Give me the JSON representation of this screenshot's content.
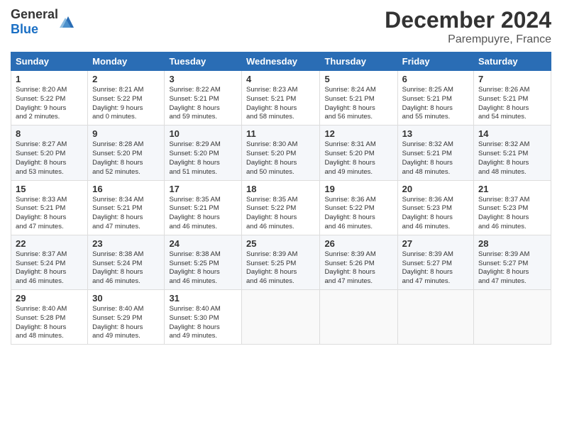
{
  "header": {
    "logo_general": "General",
    "logo_blue": "Blue",
    "title": "December 2024",
    "subtitle": "Parempuyre, France"
  },
  "calendar": {
    "columns": [
      "Sunday",
      "Monday",
      "Tuesday",
      "Wednesday",
      "Thursday",
      "Friday",
      "Saturday"
    ],
    "weeks": [
      [
        {
          "day": "1",
          "info": "Sunrise: 8:20 AM\nSunset: 5:22 PM\nDaylight: 9 hours\nand 2 minutes."
        },
        {
          "day": "2",
          "info": "Sunrise: 8:21 AM\nSunset: 5:22 PM\nDaylight: 9 hours\nand 0 minutes."
        },
        {
          "day": "3",
          "info": "Sunrise: 8:22 AM\nSunset: 5:21 PM\nDaylight: 8 hours\nand 59 minutes."
        },
        {
          "day": "4",
          "info": "Sunrise: 8:23 AM\nSunset: 5:21 PM\nDaylight: 8 hours\nand 58 minutes."
        },
        {
          "day": "5",
          "info": "Sunrise: 8:24 AM\nSunset: 5:21 PM\nDaylight: 8 hours\nand 56 minutes."
        },
        {
          "day": "6",
          "info": "Sunrise: 8:25 AM\nSunset: 5:21 PM\nDaylight: 8 hours\nand 55 minutes."
        },
        {
          "day": "7",
          "info": "Sunrise: 8:26 AM\nSunset: 5:21 PM\nDaylight: 8 hours\nand 54 minutes."
        }
      ],
      [
        {
          "day": "8",
          "info": "Sunrise: 8:27 AM\nSunset: 5:20 PM\nDaylight: 8 hours\nand 53 minutes."
        },
        {
          "day": "9",
          "info": "Sunrise: 8:28 AM\nSunset: 5:20 PM\nDaylight: 8 hours\nand 52 minutes."
        },
        {
          "day": "10",
          "info": "Sunrise: 8:29 AM\nSunset: 5:20 PM\nDaylight: 8 hours\nand 51 minutes."
        },
        {
          "day": "11",
          "info": "Sunrise: 8:30 AM\nSunset: 5:20 PM\nDaylight: 8 hours\nand 50 minutes."
        },
        {
          "day": "12",
          "info": "Sunrise: 8:31 AM\nSunset: 5:20 PM\nDaylight: 8 hours\nand 49 minutes."
        },
        {
          "day": "13",
          "info": "Sunrise: 8:32 AM\nSunset: 5:21 PM\nDaylight: 8 hours\nand 48 minutes."
        },
        {
          "day": "14",
          "info": "Sunrise: 8:32 AM\nSunset: 5:21 PM\nDaylight: 8 hours\nand 48 minutes."
        }
      ],
      [
        {
          "day": "15",
          "info": "Sunrise: 8:33 AM\nSunset: 5:21 PM\nDaylight: 8 hours\nand 47 minutes."
        },
        {
          "day": "16",
          "info": "Sunrise: 8:34 AM\nSunset: 5:21 PM\nDaylight: 8 hours\nand 47 minutes."
        },
        {
          "day": "17",
          "info": "Sunrise: 8:35 AM\nSunset: 5:21 PM\nDaylight: 8 hours\nand 46 minutes."
        },
        {
          "day": "18",
          "info": "Sunrise: 8:35 AM\nSunset: 5:22 PM\nDaylight: 8 hours\nand 46 minutes."
        },
        {
          "day": "19",
          "info": "Sunrise: 8:36 AM\nSunset: 5:22 PM\nDaylight: 8 hours\nand 46 minutes."
        },
        {
          "day": "20",
          "info": "Sunrise: 8:36 AM\nSunset: 5:23 PM\nDaylight: 8 hours\nand 46 minutes."
        },
        {
          "day": "21",
          "info": "Sunrise: 8:37 AM\nSunset: 5:23 PM\nDaylight: 8 hours\nand 46 minutes."
        }
      ],
      [
        {
          "day": "22",
          "info": "Sunrise: 8:37 AM\nSunset: 5:24 PM\nDaylight: 8 hours\nand 46 minutes."
        },
        {
          "day": "23",
          "info": "Sunrise: 8:38 AM\nSunset: 5:24 PM\nDaylight: 8 hours\nand 46 minutes."
        },
        {
          "day": "24",
          "info": "Sunrise: 8:38 AM\nSunset: 5:25 PM\nDaylight: 8 hours\nand 46 minutes."
        },
        {
          "day": "25",
          "info": "Sunrise: 8:39 AM\nSunset: 5:25 PM\nDaylight: 8 hours\nand 46 minutes."
        },
        {
          "day": "26",
          "info": "Sunrise: 8:39 AM\nSunset: 5:26 PM\nDaylight: 8 hours\nand 47 minutes."
        },
        {
          "day": "27",
          "info": "Sunrise: 8:39 AM\nSunset: 5:27 PM\nDaylight: 8 hours\nand 47 minutes."
        },
        {
          "day": "28",
          "info": "Sunrise: 8:39 AM\nSunset: 5:27 PM\nDaylight: 8 hours\nand 47 minutes."
        }
      ],
      [
        {
          "day": "29",
          "info": "Sunrise: 8:40 AM\nSunset: 5:28 PM\nDaylight: 8 hours\nand 48 minutes."
        },
        {
          "day": "30",
          "info": "Sunrise: 8:40 AM\nSunset: 5:29 PM\nDaylight: 8 hours\nand 49 minutes."
        },
        {
          "day": "31",
          "info": "Sunrise: 8:40 AM\nSunset: 5:30 PM\nDaylight: 8 hours\nand 49 minutes."
        },
        null,
        null,
        null,
        null
      ]
    ]
  }
}
